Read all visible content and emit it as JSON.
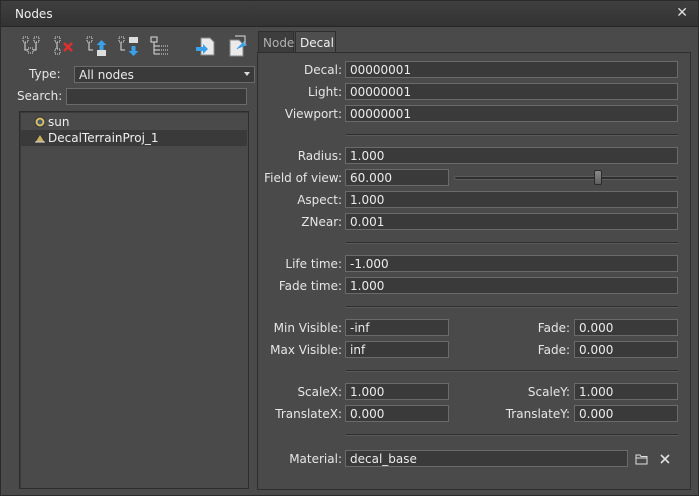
{
  "window": {
    "title": "Nodes",
    "close_glyph": "✕"
  },
  "toolbar": {
    "buttons": [
      {
        "name": "add-node-icon"
      },
      {
        "name": "remove-node-icon"
      },
      {
        "name": "move-up-icon"
      },
      {
        "name": "move-down-icon"
      },
      {
        "name": "node-tree-icon"
      },
      {
        "name": "import-node-icon"
      },
      {
        "name": "export-node-icon"
      }
    ]
  },
  "filter": {
    "type_label": "Type:",
    "type_value": "All nodes",
    "search_label": "Search:",
    "search_value": ""
  },
  "tree": {
    "items": [
      {
        "label": "sun",
        "icon": "light-icon"
      },
      {
        "label": "DecalTerrainProj_1",
        "icon": "decal-icon",
        "selected": true
      }
    ]
  },
  "tabs": [
    {
      "label": "Node"
    },
    {
      "label": "Decal",
      "active": true
    }
  ],
  "decal": {
    "decal_label": "Decal:",
    "decal_value": "00000001",
    "light_label": "Light:",
    "light_value": "00000001",
    "viewport_label": "Viewport:",
    "viewport_value": "00000001",
    "radius_label": "Radius:",
    "radius_value": "1.000",
    "fov_label": "Field of view:",
    "fov_value": "60.000",
    "fov_slider_fraction": 0.65,
    "aspect_label": "Aspect:",
    "aspect_value": "1.000",
    "znear_label": "ZNear:",
    "znear_value": "0.001",
    "lifetime_label": "Life time:",
    "lifetime_value": "-1.000",
    "fadetime_label": "Fade time:",
    "fadetime_value": "1.000",
    "minvis_label": "Min Visible:",
    "minvis_value": "-inf",
    "minfade_label": "Fade:",
    "minfade_value": "0.000",
    "maxvis_label": "Max Visible:",
    "maxvis_value": "inf",
    "maxfade_label": "Fade:",
    "maxfade_value": "0.000",
    "scalex_label": "ScaleX:",
    "scalex_value": "1.000",
    "scaley_label": "ScaleY:",
    "scaley_value": "1.000",
    "translatex_label": "TranslateX:",
    "translatex_value": "0.000",
    "translatey_label": "TranslateY:",
    "translatey_value": "0.000",
    "material_label": "Material:",
    "material_value": "decal_base"
  }
}
